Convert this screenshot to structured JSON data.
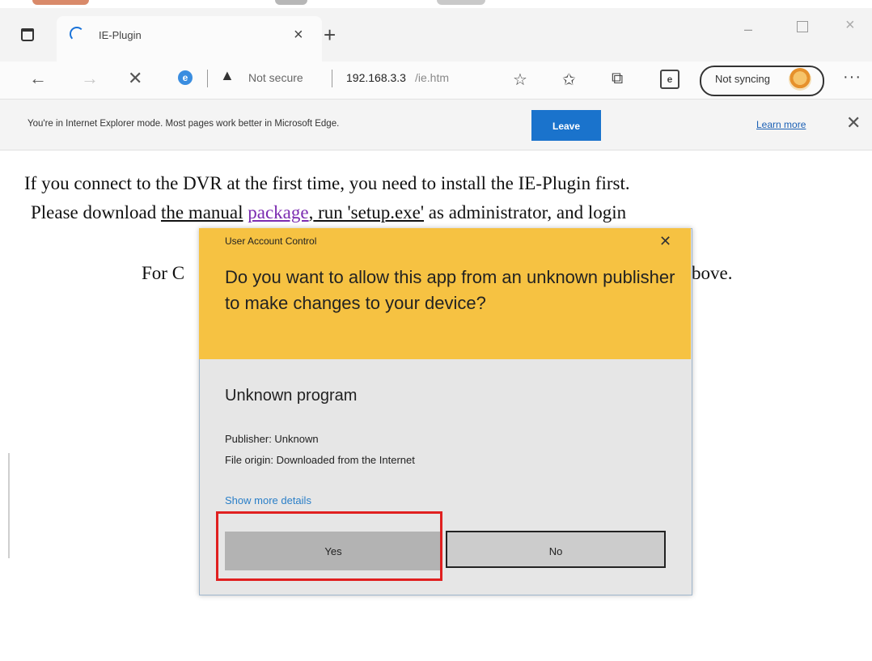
{
  "browser": {
    "tab": {
      "title": "IE-Plugin",
      "close": "×"
    },
    "new_tab": "+",
    "window_controls": {
      "minimize": "–",
      "close": "×"
    },
    "nav": {
      "back": "←",
      "forward": "→",
      "stop": "✕"
    },
    "address": {
      "security_label": "Not secure",
      "url_host": "192.168.3.3",
      "url_path": "/ie.htm",
      "site_icon": "e"
    },
    "toolbar": {
      "sync_label": "Not syncing",
      "more": "···",
      "ie_mode_icon": "e"
    },
    "icons": {
      "back": "arrow-left-icon",
      "forward": "arrow-right-icon",
      "stop": "stop-loading-icon",
      "warning": "warning-triangle-icon",
      "favorite_add": "add-favorite-icon",
      "favorites": "favorites-icon",
      "collections": "collections-icon",
      "ie_mode": "ie-mode-icon"
    }
  },
  "infobar": {
    "message": "You're in Internet Explorer mode. Most pages work better in Microsoft Edge.",
    "leave": "Leave",
    "learn_more": "Learn more",
    "close": "✕"
  },
  "page": {
    "line1": "If you connect to the DVR at the first time, you need to install the IE-Plugin first.",
    "line2_pre": "Please download ",
    "line2_the_manual": "the manual",
    "line2_space": " ",
    "line2_link": "package",
    "line2_comma": ",",
    "line2_run": " run 'setup.exe'",
    "line2_post": " as administrator, and login",
    "line3_start": "For C",
    "line3_end": "bove."
  },
  "uac_dialog": {
    "title": "User Account Control",
    "close": "✕",
    "question": "Do you want to allow this app from an unknown publisher to make changes to your device?",
    "program_name": "Unknown program",
    "publisher": "Publisher: Unknown",
    "file_origin": "File origin: Downloaded from the Internet",
    "show_more": "Show more details",
    "yes": "Yes",
    "no": "No",
    "header_color": "#f6c242",
    "highlight_color": "#e02020"
  }
}
